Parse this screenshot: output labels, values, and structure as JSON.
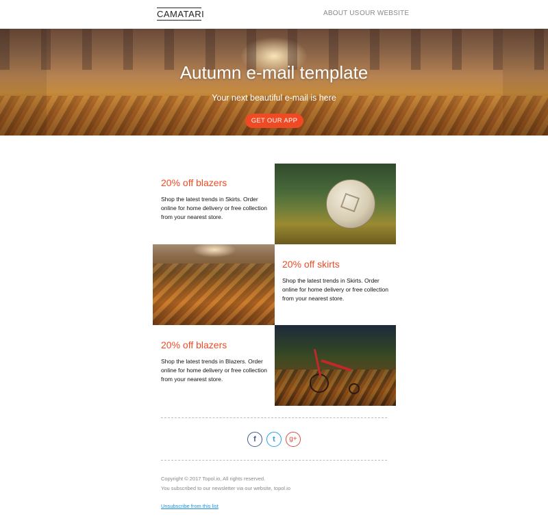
{
  "header": {
    "logo": "CAMATARI",
    "nav": [
      "ABOUT US",
      "OUR WEBSITE"
    ]
  },
  "hero": {
    "title": "Autumn e-mail template",
    "subtitle": "Your next beautiful e-mail is here",
    "cta": "GET OUR APP"
  },
  "promos": [
    {
      "title": "20% off blazers",
      "description": "Shop the latest trends in Skirts. Order online for home delivery or free collection from your nearest store."
    },
    {
      "title": "20% off skirts",
      "description": "Shop the latest trends in Skirts. Order online for home delivery or free collection from your nearest store."
    },
    {
      "title": "20% off blazers",
      "description": "Shop the latest trends in Blazers. Order online for home delivery or free collection from your nearest store."
    }
  ],
  "social": {
    "facebook": "f",
    "twitter": "t",
    "googleplus": "g+"
  },
  "footer": {
    "copyright": "Copyright © 2017 Topol.io, All rights reserved.",
    "subscribed": "You subscribed to our newsletter via our website, topol.io",
    "unsubscribe": "Unsubscribe from this list"
  },
  "colors": {
    "accent": "#f04a25",
    "facebook": "#3b5998",
    "twitter": "#1da1f2",
    "googleplus": "#dd4b39",
    "link": "#1a8ee0"
  }
}
